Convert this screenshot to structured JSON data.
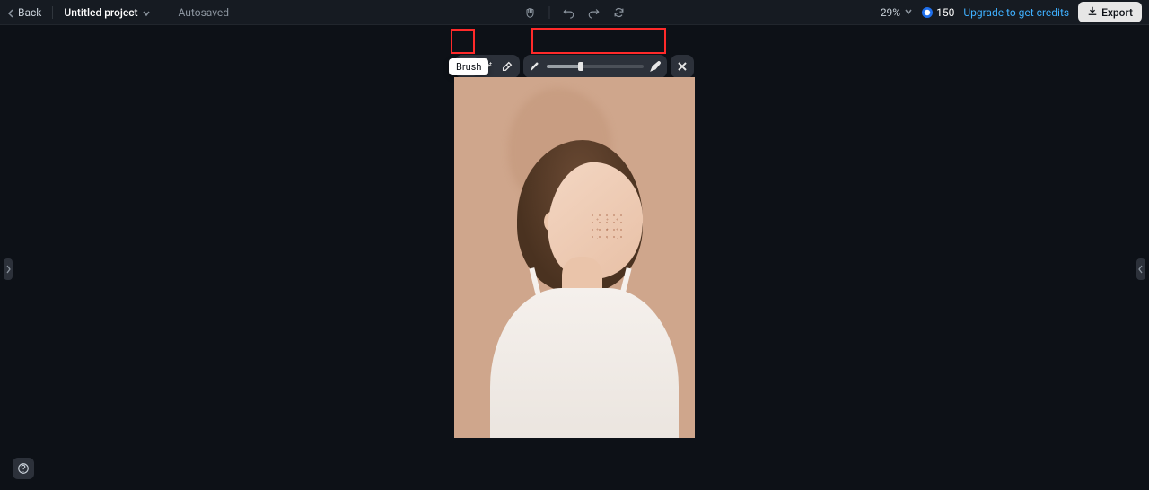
{
  "header": {
    "back_label": "Back",
    "project_name": "Untitled project",
    "save_status": "Autosaved",
    "zoom": "29%",
    "credits": "150",
    "upgrade_label": "Upgrade to get credits",
    "export_label": "Export"
  },
  "toolbar": {
    "brush_tooltip": "Brush",
    "slider_percent": 35,
    "icons": {
      "brush": "brush-icon",
      "magic_select": "magic-select-icon",
      "eraser": "eraser-icon",
      "small_brush": "small-brush-icon",
      "large_brush": "large-brush-icon",
      "close": "close-icon"
    }
  },
  "highlights": {
    "brush_box": true,
    "slider_box": true
  },
  "colors": {
    "bg": "#0d1117",
    "panel": "#2c313a",
    "accent": "#3fb0ff",
    "highlight": "#ff2a2a",
    "photo_bg": "#cfa68c"
  }
}
